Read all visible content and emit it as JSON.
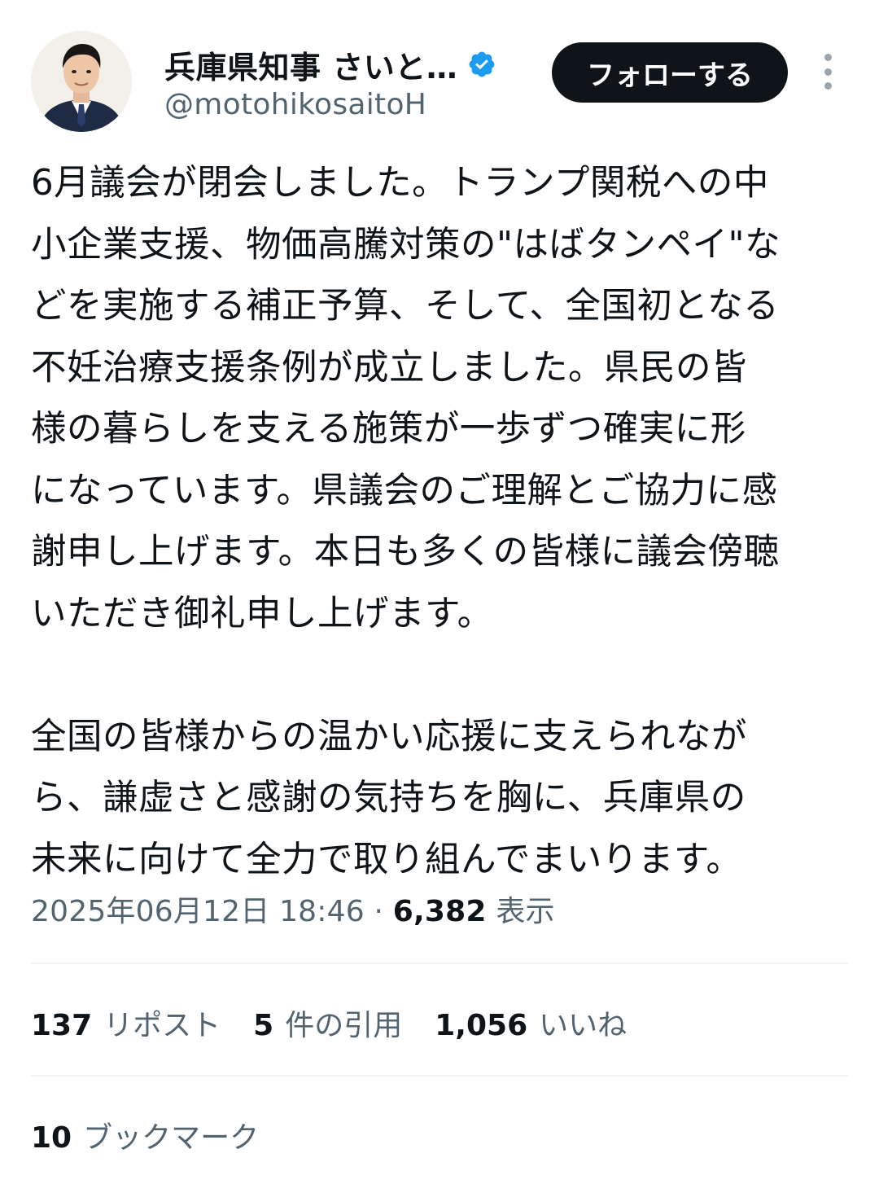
{
  "author": {
    "display_name": "兵庫県知事 さいと…",
    "handle": "@motohikosaitoH",
    "verified": true,
    "verified_color": "#1d9bf0"
  },
  "actions": {
    "follow_label": "フォローする",
    "more_icon": "more-vertical-icon"
  },
  "tweet": {
    "text": "6月議会が閉会しました。トランプ関税への中\n小企業支援、物価高騰対策の\"はばタンペイ\"な\nどを実施する補正予算、そして、全国初となる\n不妊治療支援条例が成立しました。県民の皆\n様の暮らしを支える施策が一歩ずつ確実に形\nになっています。県議会のご理解とご協力に感\n謝申し上げます。本日も多くの皆様に議会傍聴\nいただき御礼申し上げます。\n\n全国の皆様からの温かい応援に支えられなが\nら、謙虚さと感謝の気持ちを胸に、兵庫県の\n未来に向けて全力で取り組んでまいります。",
    "timestamp": "2025年06月12日 18:46",
    "separator": "·",
    "views_count": "6,382",
    "views_label": "表示"
  },
  "stats": {
    "reposts_count": "137",
    "reposts_label": "リポスト",
    "quotes_count": "5",
    "quotes_label": "件の引用",
    "likes_count": "1,056",
    "likes_label": "いいね",
    "bookmarks_count": "10",
    "bookmarks_label": "ブックマーク"
  },
  "colors": {
    "text_primary": "#0f1419",
    "text_secondary": "#536471",
    "divider": "#eff3f4",
    "button_bg": "#0f1419",
    "button_text": "#ffffff"
  }
}
